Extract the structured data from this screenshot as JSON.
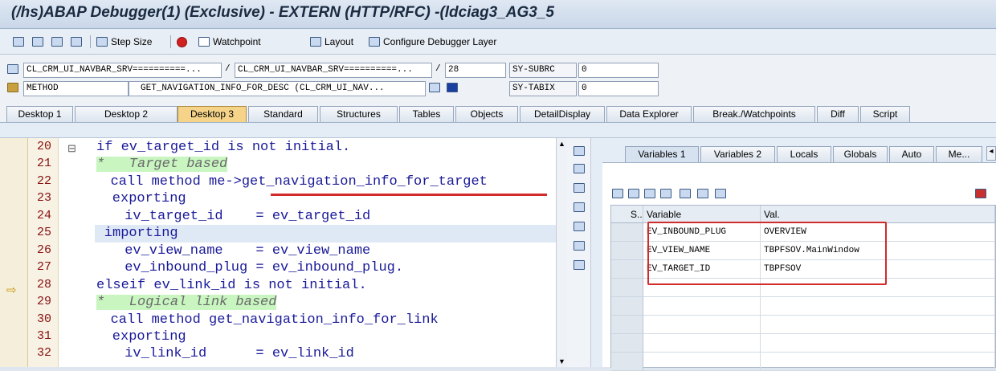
{
  "window": {
    "title": "(/hs)ABAP Debugger(1)  (Exclusive) - EXTERN (HTTP/RFC) -(ldciag3_AG3_5"
  },
  "toolbar": {
    "step_size_label": "Step Size",
    "watchpoint_label": "Watchpoint",
    "layout_label": "Layout",
    "configure_label": "Configure Debugger Layer"
  },
  "info": {
    "program": "CL_CRM_UI_NAVBAR_SRV==========...",
    "include": "CL_CRM_UI_NAVBAR_SRV==========...",
    "line": "28",
    "subrc_label": "SY-SUBRC",
    "subrc_value": "0",
    "event_type": "METHOD",
    "event_name": "GET_NAVIGATION_INFO_FOR_DESC (CL_CRM_UI_NAV...",
    "tabix_label": "SY-TABIX",
    "tabix_value": "0",
    "sep1": "/",
    "sep2": "/"
  },
  "tabs": [
    "Desktop 1",
    "Desktop 2",
    "Desktop 3",
    "Standard",
    "Structures",
    "Tables",
    "Objects",
    "DetailDisplay",
    "Data Explorer",
    "Break./Watchpoints",
    "Diff",
    "Script"
  ],
  "code": {
    "current_line": "28",
    "lines": [
      {
        "no": "20",
        "text": "if ev_target_id is not initial."
      },
      {
        "no": "21",
        "text": "*   Target based"
      },
      {
        "no": "22",
        "text": "call method me->get_navigation_info_for_target"
      },
      {
        "no": "23",
        "text": "exporting"
      },
      {
        "no": "24",
        "text": "iv_target_id    = ev_target_id"
      },
      {
        "no": "25",
        "text": "importing"
      },
      {
        "no": "26",
        "text": "ev_view_name    = ev_view_name"
      },
      {
        "no": "27",
        "text": "ev_inbound_plug = ev_inbound_plug."
      },
      {
        "no": "28",
        "text": "elseif ev_link_id is not initial."
      },
      {
        "no": "29",
        "text": "*   Logical link based"
      },
      {
        "no": "30",
        "text": "call method get_navigation_info_for_link"
      },
      {
        "no": "31",
        "text": "exporting"
      },
      {
        "no": "32",
        "text": "iv_link_id      = ev_link_id"
      }
    ]
  },
  "right_tabs": [
    "Variables 1",
    "Variables 2",
    "Locals",
    "Globals",
    "Auto",
    "Me..."
  ],
  "variables": {
    "headers": {
      "s": "S...",
      "variable": "Variable",
      "value": "Val."
    },
    "rows": [
      {
        "variable": "EV_INBOUND_PLUG",
        "value": "OVERVIEW"
      },
      {
        "variable": "EV_VIEW_NAME",
        "value": "TBPFSOV.MainWindow"
      },
      {
        "variable": "EV_TARGET_ID",
        "value": "TBPFSOV"
      }
    ]
  },
  "colors": {
    "highlight": "#d12b2b",
    "active_tab": "#f5d48a",
    "comment_bg": "#c8f5c0"
  }
}
